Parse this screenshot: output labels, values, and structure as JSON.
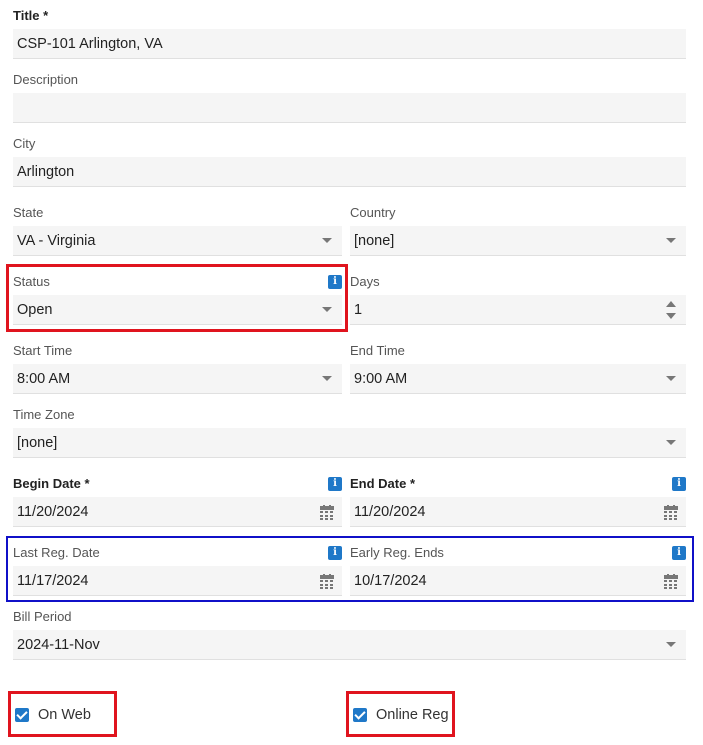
{
  "title": {
    "label": "Title *",
    "value": "CSP-101 Arlington, VA"
  },
  "description": {
    "label": "Description",
    "value": ""
  },
  "city": {
    "label": "City",
    "value": "Arlington"
  },
  "state": {
    "label": "State",
    "value": "VA - Virginia"
  },
  "country": {
    "label": "Country",
    "value": "[none]"
  },
  "status": {
    "label": "Status",
    "value": "Open",
    "info_icon": "i"
  },
  "days": {
    "label": "Days",
    "value": "1"
  },
  "start_time": {
    "label": "Start Time",
    "value": "8:00 AM"
  },
  "end_time": {
    "label": "End Time",
    "value": "9:00 AM"
  },
  "time_zone": {
    "label": "Time Zone",
    "value": "[none]"
  },
  "begin_date": {
    "label": "Begin Date *",
    "value": "11/20/2024",
    "info_icon": "i"
  },
  "end_date": {
    "label": "End Date *",
    "value": "11/20/2024",
    "info_icon": "i"
  },
  "last_reg_date": {
    "label": "Last Reg. Date",
    "value": "11/17/2024",
    "info_icon": "i"
  },
  "early_reg_ends": {
    "label": "Early Reg. Ends",
    "value": "10/17/2024",
    "info_icon": "i"
  },
  "bill_period": {
    "label": "Bill Period",
    "value": "2024-11-Nov"
  },
  "on_web": {
    "label": "On Web",
    "checked": true
  },
  "online_reg": {
    "label": "Online Reg",
    "checked": true
  },
  "colors": {
    "accent": "#1f78c8",
    "highlight_red": "#e0141e",
    "highlight_blue": "#1010c8",
    "field_bg": "#f5f5f5"
  }
}
